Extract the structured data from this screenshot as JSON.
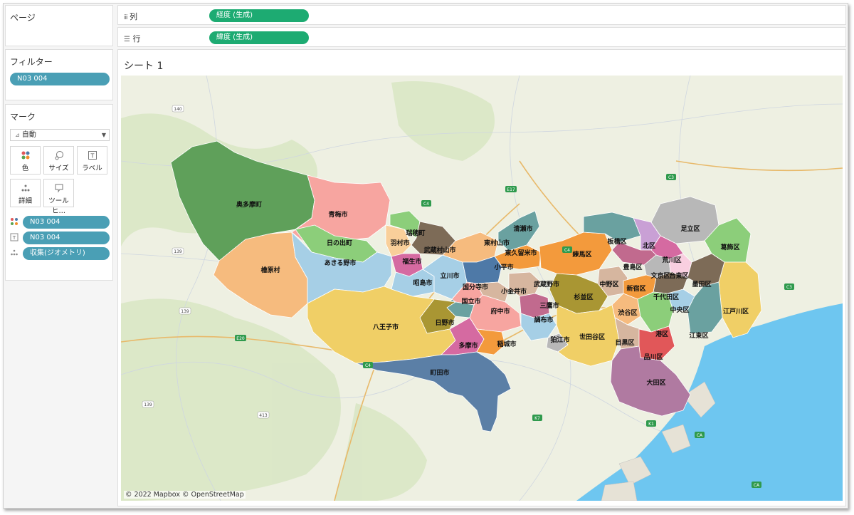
{
  "panes": {
    "pages_title": "ページ",
    "filters_title": "フィルター",
    "filters": [
      "N03 004"
    ],
    "marks_title": "マーク",
    "mark_type": "自動",
    "mark_buttons": [
      "色",
      "サイズ",
      "ラベル",
      "詳細",
      "ツールヒ…"
    ],
    "mark_fields": [
      {
        "icon": "color-icon",
        "label": "N03 004"
      },
      {
        "icon": "label-icon",
        "label": "N03 004"
      },
      {
        "icon": "detail-icon",
        "label": "収集(ジオメトリ)"
      }
    ]
  },
  "shelves": {
    "columns_label": "列",
    "columns_pill": "経度 (生成)",
    "rows_label": "行",
    "rows_pill": "緯度 (生成)"
  },
  "view": {
    "sheet_title": "シート 1",
    "attribution": "© 2022 Mapbox © OpenStreetMap"
  },
  "map_labels": {
    "okutama": "奥多摩町",
    "ome": "青梅市",
    "hinohara": "檜原村",
    "hinode": "日の出町",
    "akiruno": "あきる野市",
    "hamura": "羽村市",
    "mizuho": "瑞穂町",
    "musashimurayama": "武蔵村山市",
    "fussa": "福生市",
    "akishima": "昭島市",
    "tachikawa": "立川市",
    "higashimurayama": "東村山市",
    "kiyose": "清瀬市",
    "higashikurume": "東久留米市",
    "kodaira": "小平市",
    "kokubunji": "国分寺市",
    "kunitachi": "国立市",
    "koganei": "小金井市",
    "musashino": "武蔵野市",
    "mitaka": "三鷹市",
    "fuchu": "府中市",
    "chofu": "調布市",
    "komae": "狛江市",
    "hino": "日野市",
    "hachioji": "八王子市",
    "tama": "多摩市",
    "inagi": "稲城市",
    "machida": "町田市",
    "nerima": "練馬区",
    "itabashi": "板橋区",
    "kita": "北区",
    "adachi": "足立区",
    "katsushika": "葛飾区",
    "arakawa": "荒川区",
    "toshima": "豊島区",
    "bunkyo": "文京区",
    "taito": "台東区",
    "sumida": "墨田区",
    "edogawa": "江戸川区",
    "nakano": "中野区",
    "suginami": "杉並区",
    "shinjuku": "新宿区",
    "chiyoda": "千代田区",
    "chuo": "中央区",
    "koto": "江東区",
    "shibuya": "渋谷区",
    "minato": "港区",
    "setagaya": "世田谷区",
    "meguro": "目黒区",
    "shinagawa": "品川区",
    "ota": "大田区"
  },
  "road_labels": [
    "140",
    "139",
    "139",
    "E20",
    "139",
    "413",
    "C4",
    "C4",
    "E17",
    "C3",
    "C3",
    "K7",
    "K1",
    "CA",
    "CA",
    "C4"
  ],
  "colors": {
    "pill_blue": "#4a9fb5",
    "pill_green": "#1dab72",
    "water": "#6ec6f0",
    "land": "#eef0e2"
  }
}
